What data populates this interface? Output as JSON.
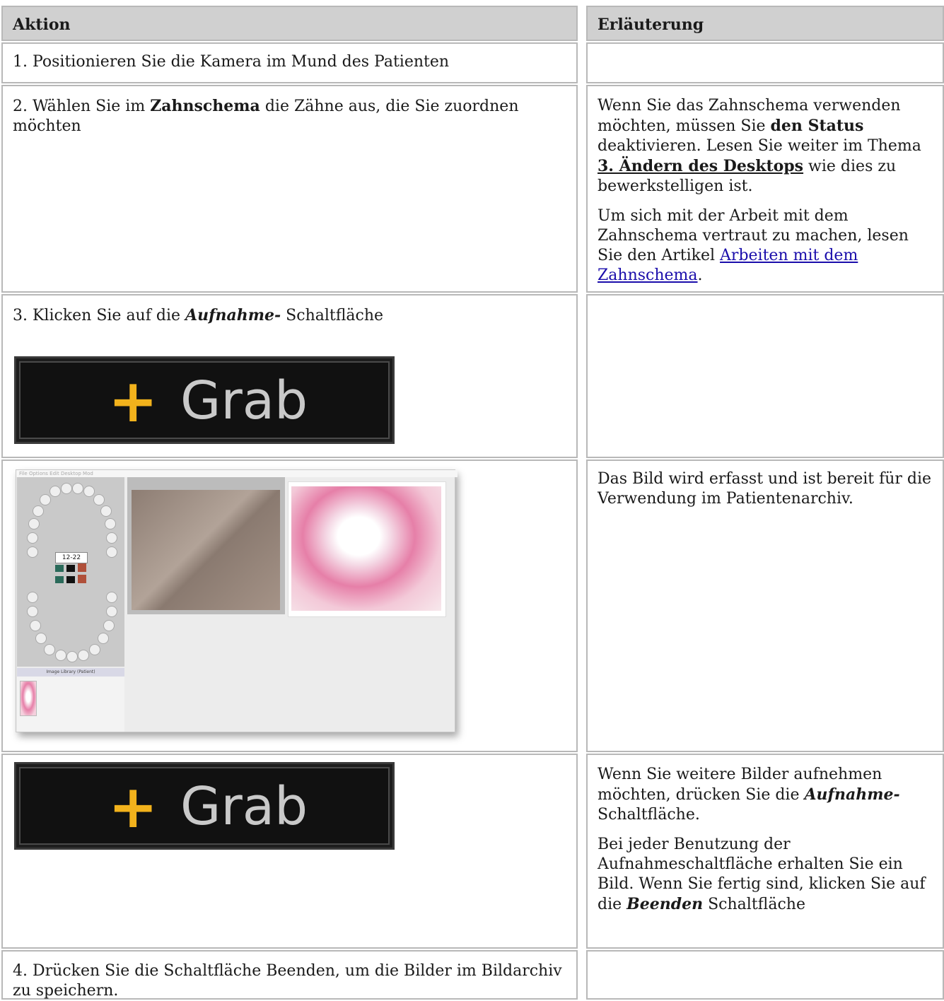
{
  "table": {
    "headers": {
      "action": "Aktion",
      "explanation": "Erläuterung"
    },
    "rows": [
      {
        "action": "1. Positionieren Sie die Kamera im Mund des Patienten"
      },
      {
        "action_pre": "2. Wählen Sie im ",
        "action_bold": "Zahnschema",
        "action_post": " die Zähne aus, die Sie zuordnen möchten",
        "expl1_a": "Wenn Sie das Zahnschema verwenden möchten, müssen Sie ",
        "expl1_b": "den Status",
        "expl1_c": " deaktivieren. Lesen Sie weiter im Thema ",
        "expl1_link": "3. Ändern des Desktops",
        "expl1_d": " wie dies zu bewerkstelligen ist.",
        "expl2_a": "Um sich mit der Arbeit mit dem Zahnschema vertraut zu machen, lesen Sie den Artikel ",
        "expl2_link": "Arbeiten mit dem Zahnschema",
        "expl2_b": "."
      },
      {
        "action_pre": "3. Klicken Sie auf die ",
        "action_bold": "Aufnahme-",
        "action_post": " Schaltfläche",
        "button_label": "Grab",
        "button_icon": "+"
      },
      {
        "explanation": "Das Bild wird erfasst und ist bereit für die Verwendung im Patientenarchiv.",
        "screenshot": {
          "menu": "File   Options   Edit   Desktop   Mod",
          "tooth_label": "12-22",
          "library_label": "Image Library (Patient)"
        }
      },
      {
        "button_label": "Grab",
        "button_icon": "+",
        "expl1_a": "Wenn Sie weitere Bilder aufnehmen möchten, drücken Sie die ",
        "expl1_bold": "Aufnahme-",
        "expl1_b": "Schaltfläche.",
        "expl2_a": "Bei jeder Benutzung der Aufnahmeschaltfläche erhalten Sie ein Bild. Wenn Sie fertig sind, klicken Sie auf die ",
        "expl2_bold": "Beenden",
        "expl2_b": " Schaltfläche"
      },
      {
        "action": "4. Drücken Sie die Schaltfläche Beenden, um die Bilder im Bildarchiv zu speichern."
      }
    ]
  },
  "colors": {
    "header_bg": "#d0d0d0",
    "border": "#b8b8b8",
    "link": "#1a0dab",
    "plus": "#f2b21c"
  }
}
